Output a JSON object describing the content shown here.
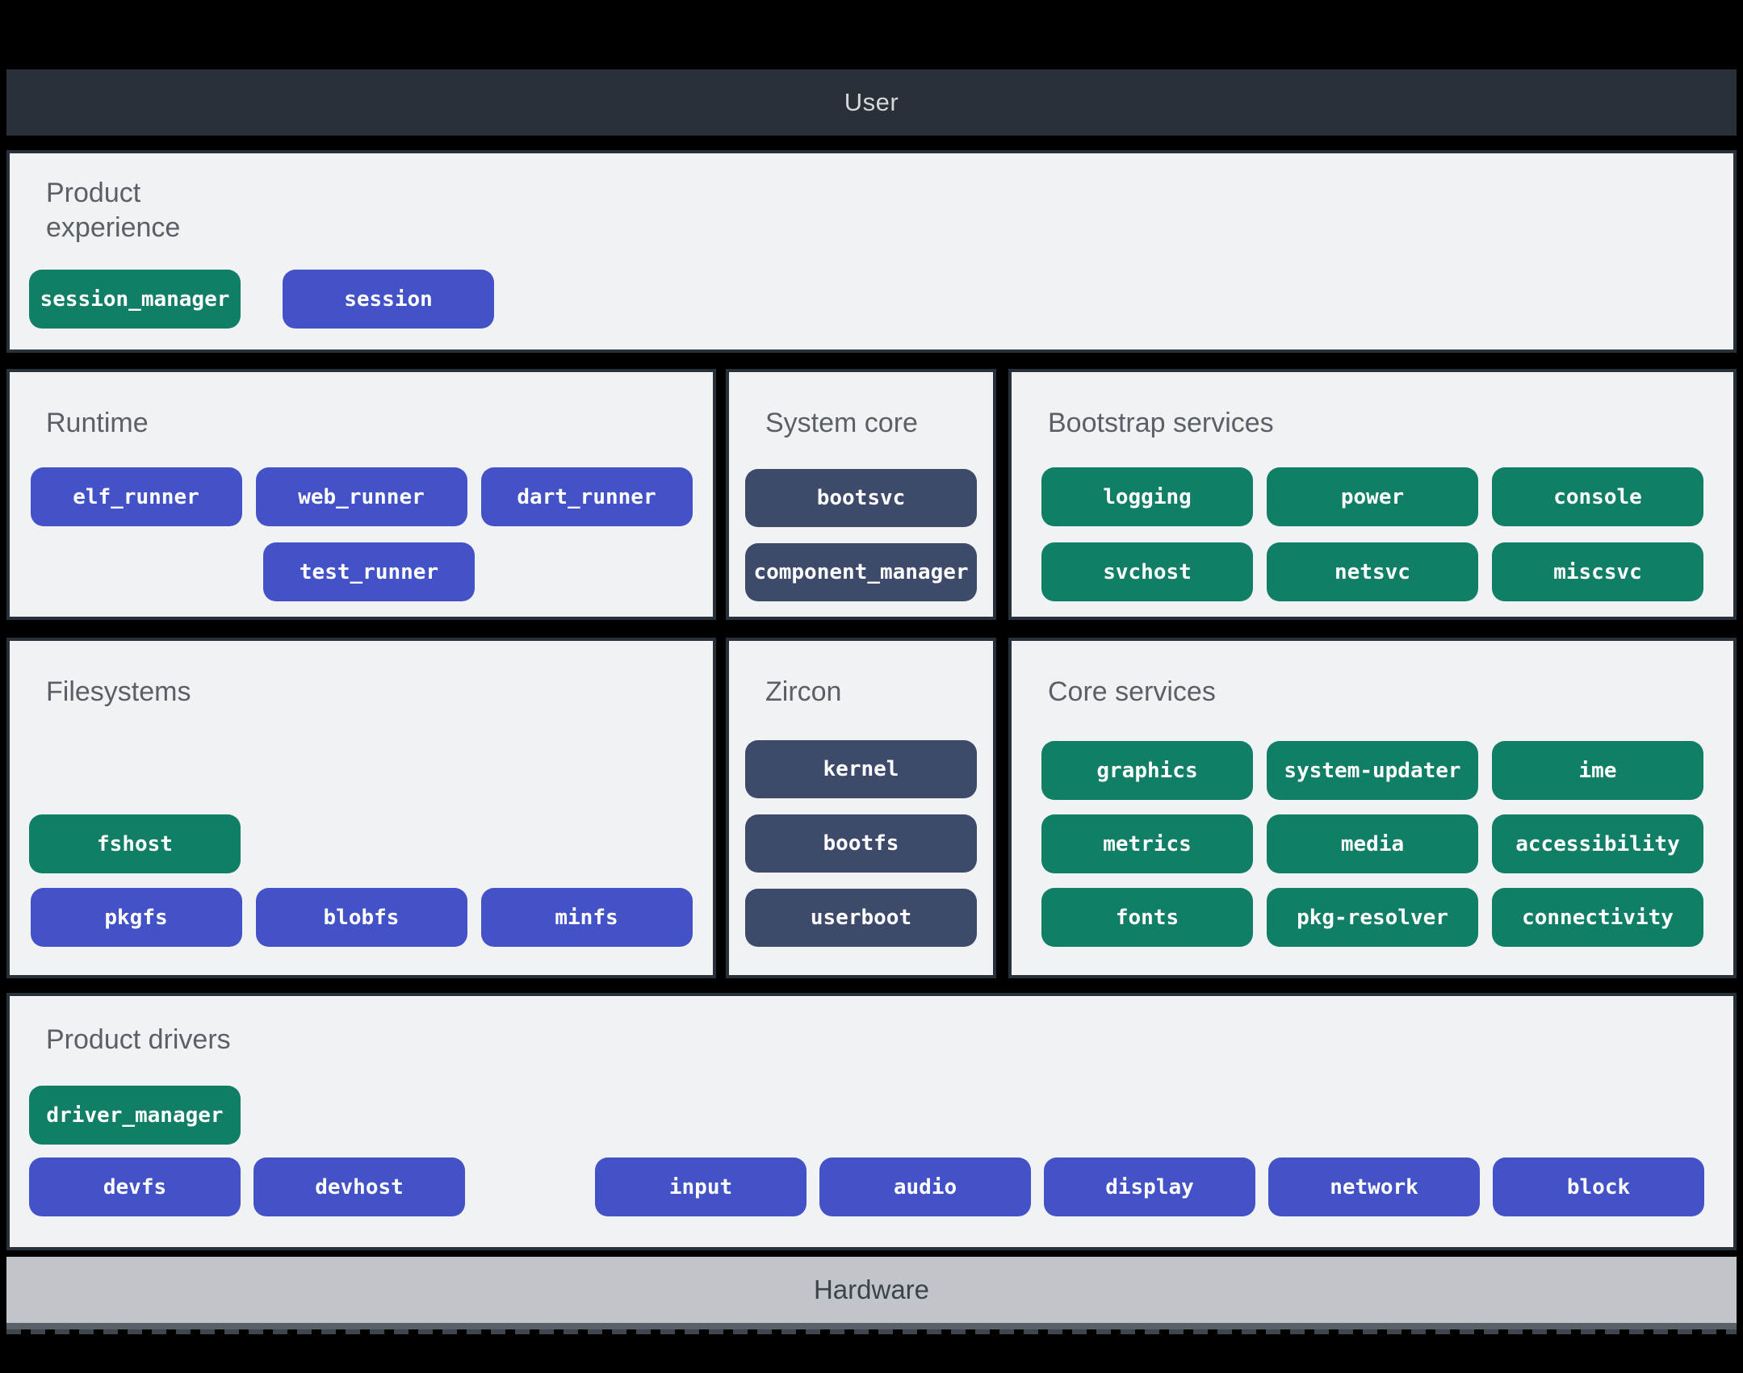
{
  "layers": {
    "user": "User",
    "hardware": "Hardware"
  },
  "colors": {
    "green_node": "#117E66",
    "indigo_node": "#4352C7",
    "slate_node": "#3D4A6A",
    "layer_bar_bg": "#293038",
    "panel_bg": "#F0F2F4",
    "panel_border": "#28303A",
    "hardware_bg": "#C1C4C9",
    "title_text": "#5B6066"
  },
  "sections": {
    "product_experience": {
      "title": "Product experience",
      "row1": [
        "session_manager",
        "session"
      ]
    },
    "runtime": {
      "title": "Runtime",
      "row1": [
        "elf_runner",
        "web_runner",
        "dart_runner"
      ],
      "row2": [
        "test_runner"
      ]
    },
    "system_core": {
      "title": "System core",
      "row1": [
        "bootsvc"
      ],
      "row2": [
        "component_manager"
      ]
    },
    "bootstrap_services": {
      "title": "Bootstrap services",
      "row1": [
        "logging",
        "power",
        "console"
      ],
      "row2": [
        "svchost",
        "netsvc",
        "miscsvc"
      ]
    },
    "filesystems": {
      "title": "Filesystems",
      "row1": [
        "fshost"
      ],
      "row2": [
        "pkgfs",
        "blobfs",
        "minfs"
      ]
    },
    "zircon": {
      "title": "Zircon",
      "row1": [
        "kernel"
      ],
      "row2": [
        "bootfs"
      ],
      "row3": [
        "userboot"
      ]
    },
    "core_services": {
      "title": "Core services",
      "row1": [
        "graphics",
        "system-updater",
        "ime"
      ],
      "row2": [
        "metrics",
        "media",
        "accessibility"
      ],
      "row3": [
        "fonts",
        "pkg-resolver",
        "connectivity"
      ]
    },
    "product_drivers": {
      "title": "Product drivers",
      "row1": [
        "driver_manager"
      ],
      "row2": [
        "devfs",
        "devhost"
      ],
      "row3": [
        "input",
        "audio",
        "display",
        "network",
        "block"
      ]
    }
  }
}
